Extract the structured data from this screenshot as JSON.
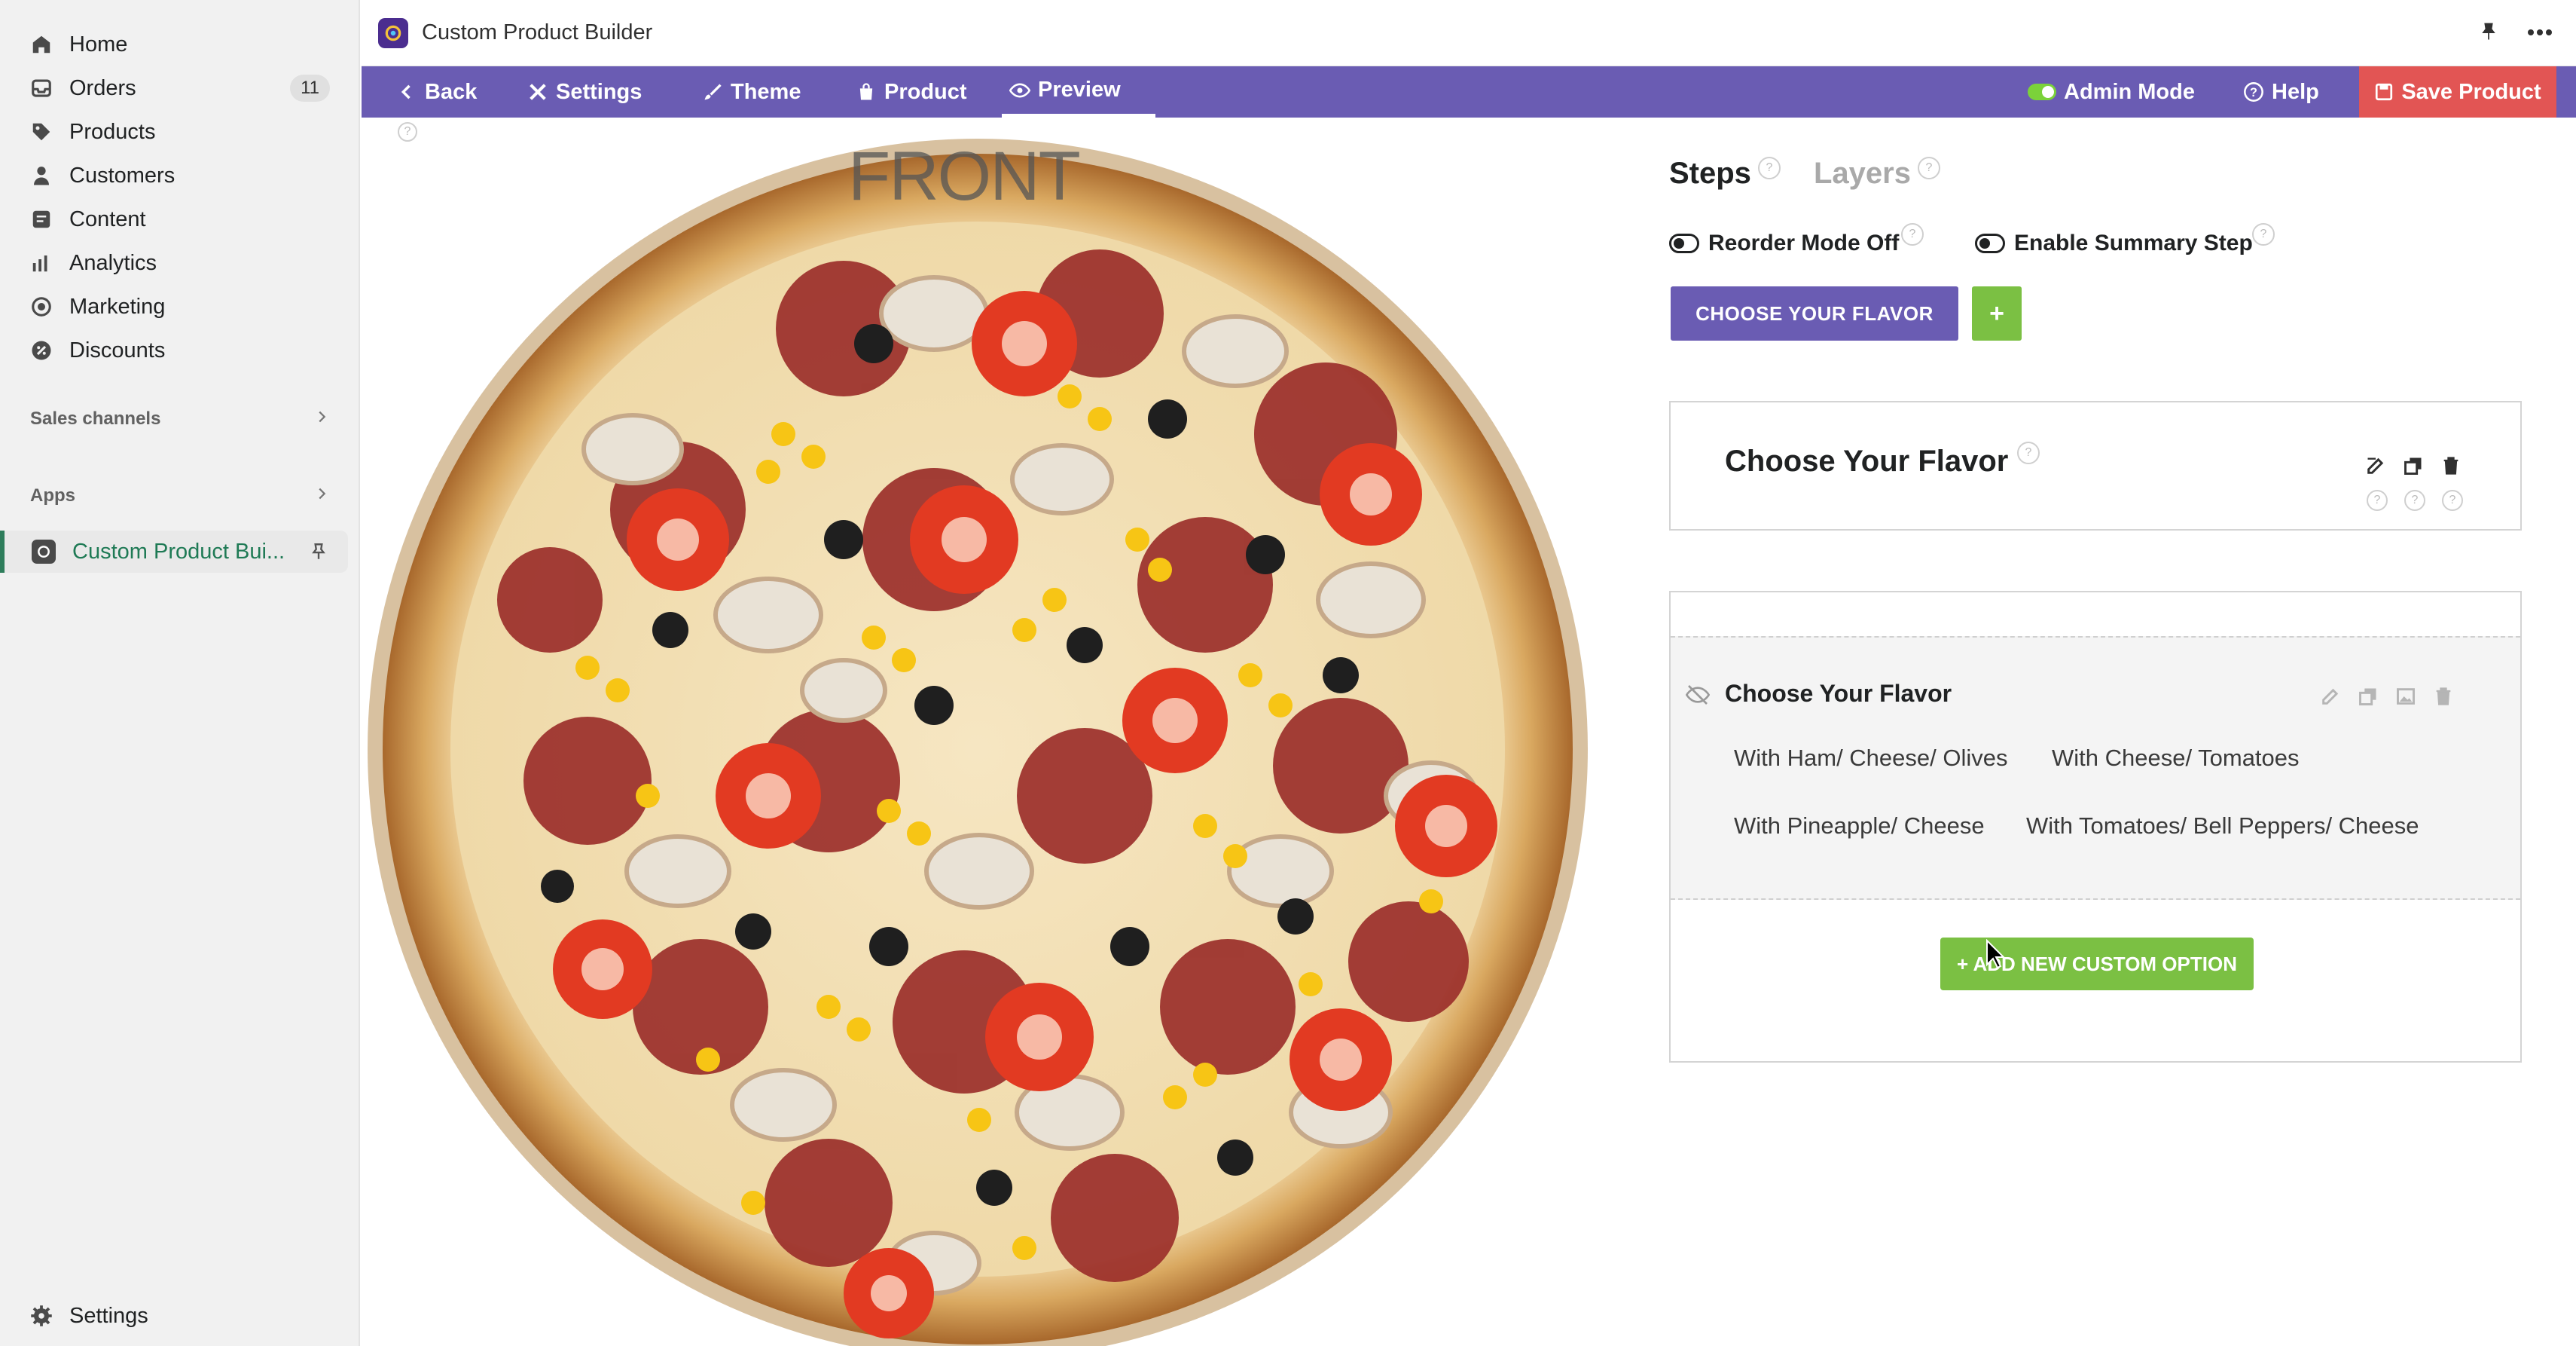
{
  "sidebar": {
    "items": [
      {
        "label": "Home",
        "icon": "home-icon"
      },
      {
        "label": "Orders",
        "icon": "orders-icon",
        "badge": "11"
      },
      {
        "label": "Products",
        "icon": "tag-icon"
      },
      {
        "label": "Customers",
        "icon": "person-icon"
      },
      {
        "label": "Content",
        "icon": "content-icon"
      },
      {
        "label": "Analytics",
        "icon": "analytics-icon"
      },
      {
        "label": "Marketing",
        "icon": "marketing-icon"
      },
      {
        "label": "Discounts",
        "icon": "discount-icon"
      }
    ],
    "sales_channels": "Sales channels",
    "apps": "Apps",
    "active_app": "Custom Product Bui...",
    "settings": "Settings"
  },
  "topbar": {
    "title": "Custom Product Builder"
  },
  "menubar": {
    "back": "Back",
    "settings": "Settings",
    "theme": "Theme",
    "product": "Product",
    "preview": "Preview",
    "admin_mode": "Admin Mode",
    "help": "Help",
    "save": "Save Product"
  },
  "canvas": {
    "view_label": "FRONT"
  },
  "panel": {
    "tabs": {
      "steps": "Steps",
      "layers": "Layers"
    },
    "reorder_mode": "Reorder Mode Off",
    "summary_step": "Enable Summary Step",
    "step_button": "CHOOSE YOUR FLAVOR",
    "add_step": "+",
    "step_card_title": "Choose Your Flavor",
    "option_group_title": "Choose Your Flavor",
    "options": [
      "With Ham/ Cheese/ Olives",
      "With Cheese/ Tomatoes",
      "With Pineapple/ Cheese",
      "With Tomatoes/ Bell Peppers/ Cheese"
    ],
    "add_option": "+ ADD NEW CUSTOM OPTION",
    "help_mark": "?"
  },
  "colors": {
    "menubar": "#6a5cb3",
    "save": "#e25554",
    "accent_green": "#7bc043",
    "active_app": "#1f7a55"
  }
}
